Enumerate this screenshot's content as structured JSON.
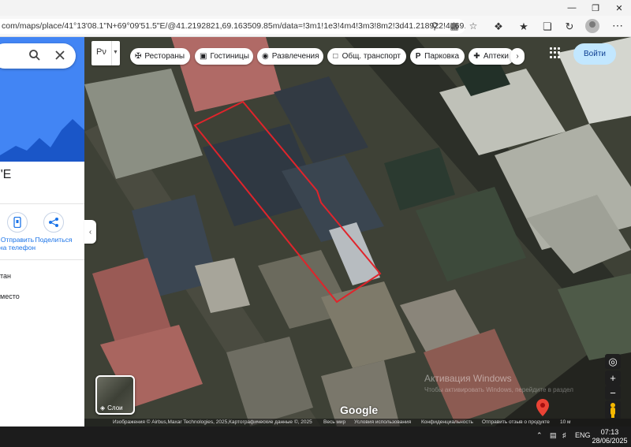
{
  "browser": {
    "url": "com/maps/place/41°13'08.1\"N+69°09'51.5\"E/@41.2192821,69.163509.85m/data=!3m1!1e3!4m4!3m3!8m2!3d41.218922!4d69.1643...",
    "icons": [
      "location-icon",
      "grid-icon",
      "star-icon",
      "extension-icon",
      "favorites-icon",
      "collections-icon",
      "history-icon"
    ]
  },
  "panel": {
    "coord_fragment": "\"E",
    "actions": [
      {
        "label_line1": "Отправить",
        "label_line2": "на телефон"
      },
      {
        "label_line1": "Поделиться",
        "label_line2": ""
      }
    ],
    "lines": [
      "тан",
      "место"
    ]
  },
  "map": {
    "layer_select": "Рν",
    "chips": [
      {
        "label": "Рестораны",
        "icon": "fork-knife-icon"
      },
      {
        "label": "Гостиницы",
        "icon": "bed-icon"
      },
      {
        "label": "Развлечения",
        "icon": "camera-icon"
      },
      {
        "label": "Общ. транспорт",
        "icon": "bus-icon"
      },
      {
        "label": "Парковка",
        "icon": "parking-icon"
      },
      {
        "label": "Аптеки",
        "icon": "pharmacy-icon"
      }
    ],
    "signin_label": "Войти",
    "layers_label": "Слои",
    "google_label": "Google",
    "attribution": {
      "imagery": "Изображения © Airbus,Maxar Technologies, 2025,Картографические данные ©, 2025",
      "world": "Весь мир",
      "terms": "Условия использования",
      "privacy": "Конфиденциальность",
      "feedback": "Отправить отзыв о продукте",
      "scale": "10 м"
    },
    "watermark_title": "Активация Windows",
    "watermark_sub": "Чтобы активировать Windows, перейдите в раздел"
  },
  "taskbar": {
    "lang": "ENG",
    "time": "07:13",
    "date": "28/06/2025"
  },
  "colors": {
    "accent": "#4285f4",
    "outline": "#e0242b"
  }
}
